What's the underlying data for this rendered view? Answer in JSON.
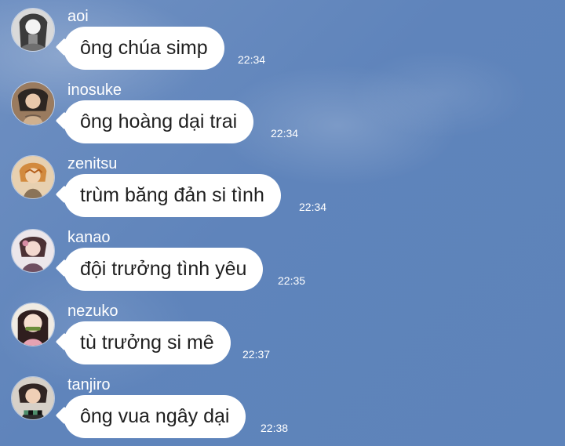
{
  "chat": {
    "messages": [
      {
        "sender": "aoi",
        "text": "ông chúa simp",
        "time": "22:34"
      },
      {
        "sender": "inosuke",
        "text": "ông hoàng dại trai",
        "time": "22:34"
      },
      {
        "sender": "zenitsu",
        "text": "trùm băng đản si tình",
        "time": "22:34"
      },
      {
        "sender": "kanao",
        "text": "đội trưởng tình yêu",
        "time": "22:35"
      },
      {
        "sender": "nezuko",
        "text": "tù trưởng si mê",
        "time": "22:37"
      },
      {
        "sender": "tanjiro",
        "text": "ông vua ngây dại",
        "time": "22:38"
      }
    ]
  },
  "icons": {
    "avatar_style": "circular character portrait"
  },
  "colors": {
    "background": "#5f84bb",
    "bubble": "#ffffff",
    "text": "#1f1f1f",
    "sender_text": "#ffffff"
  }
}
